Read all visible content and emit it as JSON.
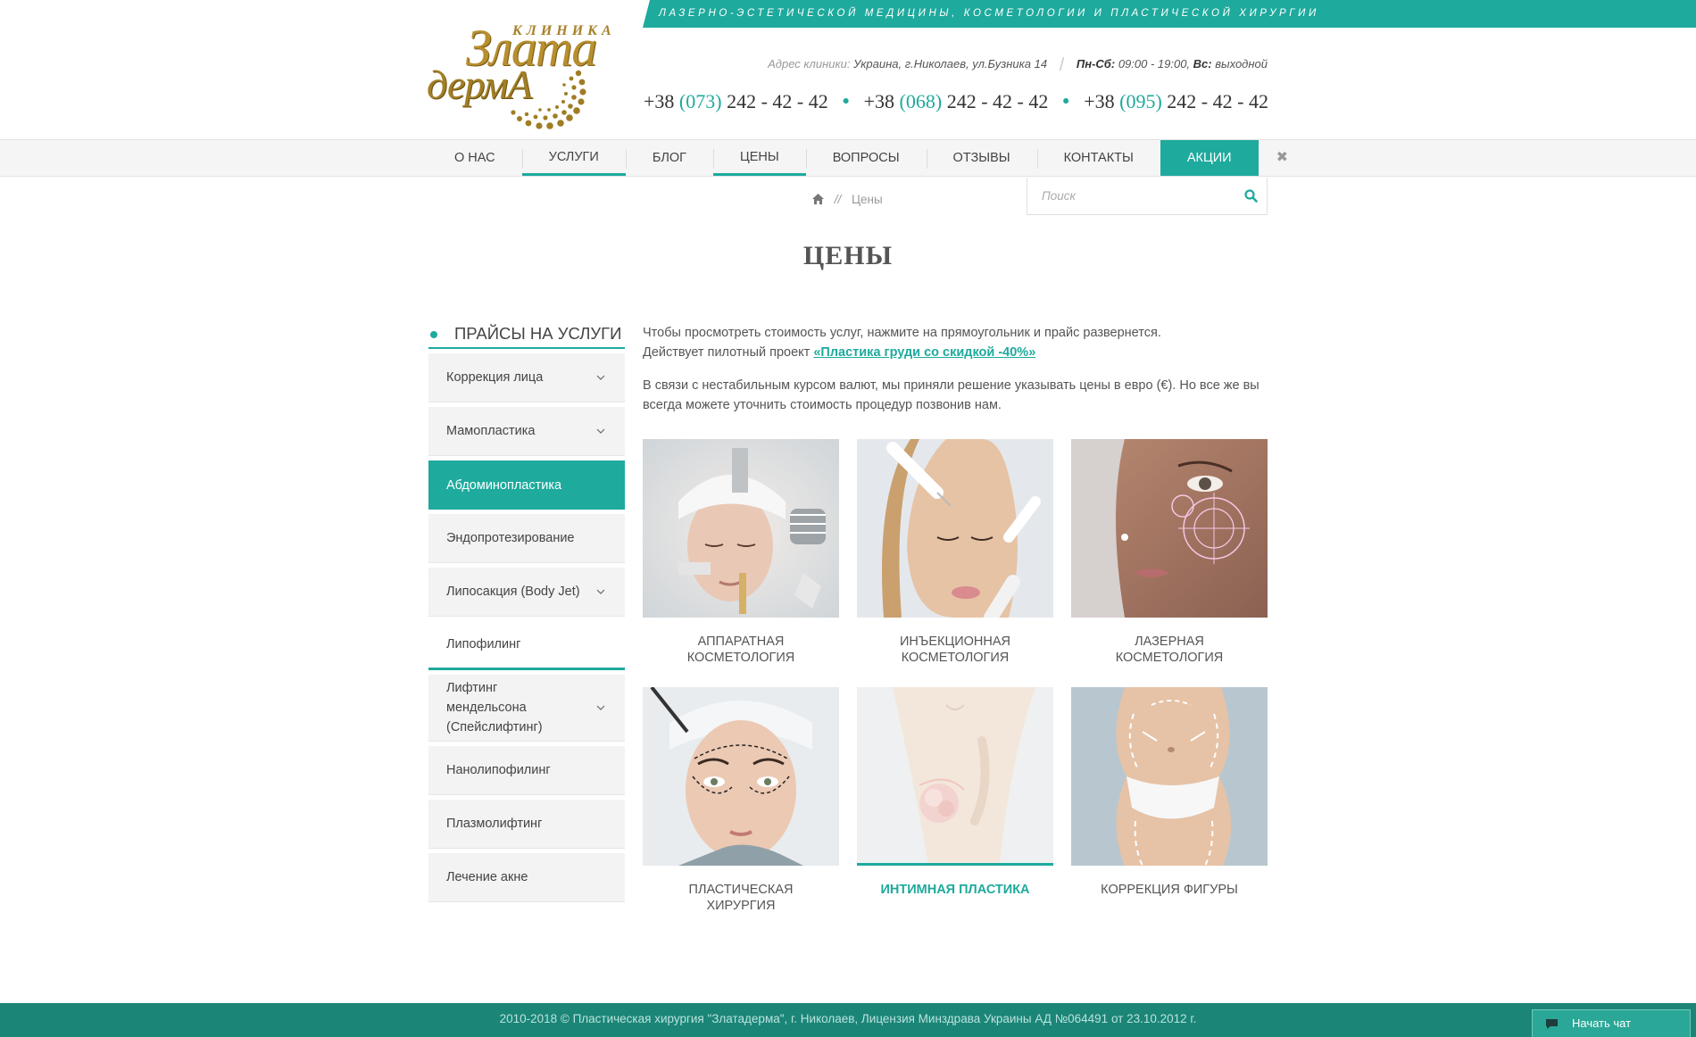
{
  "header": {
    "tagline": "лазерно-эстетической медицины, косметологии и пластической хирургии",
    "logo": {
      "top": "КЛИНИКА",
      "line1": "Злата",
      "line2": "дермА"
    },
    "address_label": "Адрес клиники:",
    "address_value": "Украина, г.Николаев, ул.Бузника 14",
    "hours_weekday_label": "Пн-Сб:",
    "hours_weekday_value": "09:00 - 19:00,",
    "hours_sunday_label": "Вс:",
    "hours_sunday_value": "выходной",
    "phones": [
      {
        "prefix": "+38",
        "code": "(073)",
        "number": "242 - 42 - 42"
      },
      {
        "prefix": "+38",
        "code": "(068)",
        "number": "242 - 42 - 42"
      },
      {
        "prefix": "+38",
        "code": "(095)",
        "number": "242 - 42 - 42"
      }
    ]
  },
  "nav": {
    "items": [
      {
        "label": "О нас"
      },
      {
        "label": "Услуги"
      },
      {
        "label": "Блог"
      },
      {
        "label": "Цены"
      },
      {
        "label": "Вопросы"
      },
      {
        "label": "Отзывы"
      },
      {
        "label": "Контакты"
      },
      {
        "label": "Акции"
      }
    ],
    "close_glyph": "✖"
  },
  "breadcrumb": {
    "separator": "//",
    "current": "Цены"
  },
  "search": {
    "placeholder": "Поиск"
  },
  "page": {
    "title": "Цены"
  },
  "sidebar": {
    "title": "Прайсы на услуги",
    "items": [
      {
        "label": "Коррекция лица"
      },
      {
        "label": "Мамопластика"
      },
      {
        "label": "Абдоминопластика"
      },
      {
        "label": "Эндопротезирование"
      },
      {
        "label": "Липосакция (Body Jet)"
      },
      {
        "label": "Липофилинг"
      },
      {
        "label": "Лифтинг мендельсона (Спейслифтинг)"
      },
      {
        "label": "Нанолипофилинг"
      },
      {
        "label": "Плазмолифтинг"
      },
      {
        "label": "Лечение акне"
      }
    ]
  },
  "intro": {
    "line1": "Чтобы просмотреть стоимость услуг, нажмите на прямоугольник и прайс развернется.",
    "line2_text": "Действует пилотный проект ",
    "line2_link": "«Пластика груди со скидкой -40%»",
    "para2": "В связи с нестабильным курсом валют, мы приняли решение указывать цены в евро (€). Но все же вы всегда можете уточнить стоимость процедур позвонив нам."
  },
  "categories": [
    {
      "label": "Аппаратная косметология"
    },
    {
      "label": "Инъекционная косметология"
    },
    {
      "label": "Лазерная косметология"
    },
    {
      "label": "Пластическая хирургия"
    },
    {
      "label": "Интимная пластика"
    },
    {
      "label": "Коррекция фигуры"
    }
  ],
  "footer": {
    "text": "2010-2018 © Пластическая хирургия \"Златадерма\", г. Николаев, Лицензия Минздрава Украины АД №064491 от 23.10.2012 г."
  },
  "chat": {
    "label": "Начать чат"
  },
  "colors": {
    "accent": "#1eaa9d",
    "footer": "#1b8577",
    "gold": "#b88f2f"
  }
}
